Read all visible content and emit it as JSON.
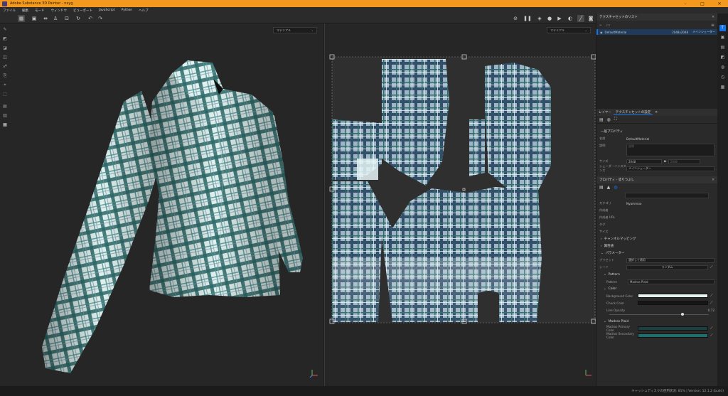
{
  "window": {
    "title": "Adobe Substance 3D Painter - nxyg"
  },
  "menu": [
    "ファイル",
    "編集",
    "モード",
    "ウィンドウ",
    "ビューポート",
    "JavaScript",
    "Python",
    "ヘルプ"
  ],
  "viewport_3d": {
    "material_dropdown": "マテリアル"
  },
  "viewport_2d": {
    "material_dropdown": "マテリアル"
  },
  "texture_set_list": {
    "title": "テクスチャセットのリスト",
    "item": {
      "name": "DefaultMaterial",
      "size": "2048x2048",
      "shader": "メインシェーダー"
    }
  },
  "tabs": [
    "レイヤー",
    "テクスチャセットの設定"
  ],
  "general_properties": {
    "title": "一般プロパティ",
    "name_label": "名前",
    "name_value": "DefaultMaterial",
    "desc_label": "説明",
    "desc_placeholder": "説明",
    "size_label": "サイズ",
    "size_value": "2048",
    "size_value2": "2048",
    "shader_label": "シェーダーインスタンス",
    "shader_value": "メインシェーダー"
  },
  "properties": {
    "title": "プロパティ - 塗りつぶし",
    "category_label": "カテゴリ",
    "category_value": "Nyammoo",
    "author_label": "作成者",
    "author_url_label": "作成者 URL",
    "tags_label": "タグ",
    "size_label": "サイズ",
    "channel_mapping": "チャンネルマッピング",
    "attributes": "属性値",
    "parameters": "パラメーター",
    "preset_label": "プリセット",
    "preset_value": "選択して適用",
    "seed_label": "シード",
    "seed_value": "ランダム",
    "pattern_section": "Pattern",
    "pattern_label": "Pattern",
    "pattern_value": "Madras Plaid",
    "color_section": "Color",
    "bg_color_label": "Background Color",
    "check_color_label": "Check Color",
    "line_opacity_label": "Line Opacity",
    "line_opacity_value": "0.72",
    "madras_section": "Madras Plaid",
    "primary_label": "Madras Primary Color",
    "secondary_label": "Madras Secondary Color"
  },
  "colors": {
    "bg": "#e6f4f1",
    "check": "#161616",
    "primary": "#1c3f40",
    "secondary": "#1c6f6d",
    "accent": "#1473e6"
  },
  "status": {
    "text": "キャッシュディスクの使用状況: 81% | Version: 12.1.2 (build)"
  }
}
